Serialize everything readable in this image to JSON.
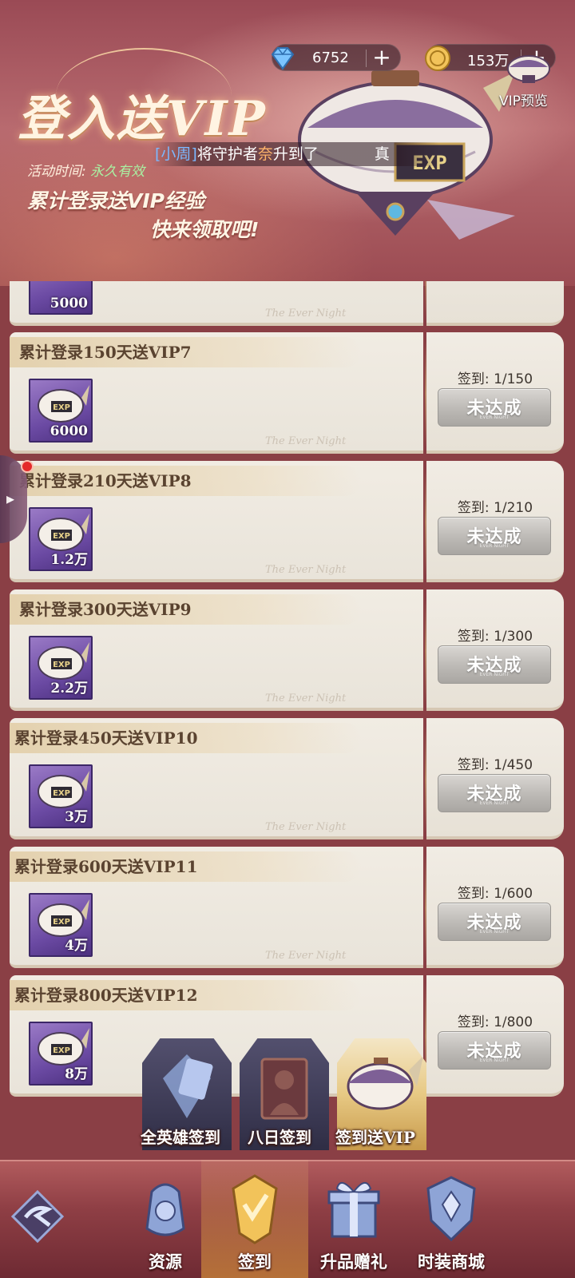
{
  "header": {
    "title": "登入送VIP",
    "activity_label": "活动时间:",
    "activity_value": "永久有效",
    "promo_line1": "累计登录送VIP经验",
    "promo_line2": "快来领取吧!",
    "ticker_prefix": "[小周]",
    "ticker_mid": "将守护者",
    "ticker_name": "奈",
    "ticker_action": "升到了",
    "ticker_suffix": "真",
    "diamond_amount": "6752",
    "gold_amount": "153万",
    "vip_preview_label": "VIP预览",
    "airship_badge": "EXP"
  },
  "list": {
    "watermark": "The Ever Night",
    "progress_prefix": "签到: ",
    "button_label": "未达成",
    "button_sub": "EVER NIGHT",
    "items": [
      {
        "title": "",
        "reward": "5000",
        "progress": ""
      },
      {
        "title": "累计登录150天送VIP7",
        "reward": "6000",
        "progress": "1/150"
      },
      {
        "title": "累计登录210天送VIP8",
        "reward": "1.2万",
        "progress": "1/210"
      },
      {
        "title": "累计登录300天送VIP9",
        "reward": "2.2万",
        "progress": "1/300"
      },
      {
        "title": "累计登录450天送VIP10",
        "reward": "3万",
        "progress": "1/450"
      },
      {
        "title": "累计登录600天送VIP11",
        "reward": "4万",
        "progress": "1/600"
      },
      {
        "title": "累计登录800天送VIP12",
        "reward": "8万",
        "progress": "1/800"
      }
    ]
  },
  "subtabs": [
    {
      "label": "全英雄签到",
      "active": false
    },
    {
      "label": "八日签到",
      "active": false
    },
    {
      "label": "签到送VIP",
      "active": true
    }
  ],
  "bottomnav": [
    {
      "label": "资源",
      "icon": "resource-bag-icon"
    },
    {
      "label": "签到",
      "icon": "checkin-crest-icon",
      "active": true
    },
    {
      "label": "升品赠礼",
      "icon": "gift-box-icon"
    },
    {
      "label": "时装商城",
      "icon": "fashion-crest-icon"
    }
  ],
  "colors": {
    "banner": "#a8555c",
    "card": "#efeae1",
    "title_text": "#5a4330",
    "reward_bg": "#6b4aa3",
    "button_gray": "#bcb9b5",
    "nav_bg": "#8f3f45"
  }
}
